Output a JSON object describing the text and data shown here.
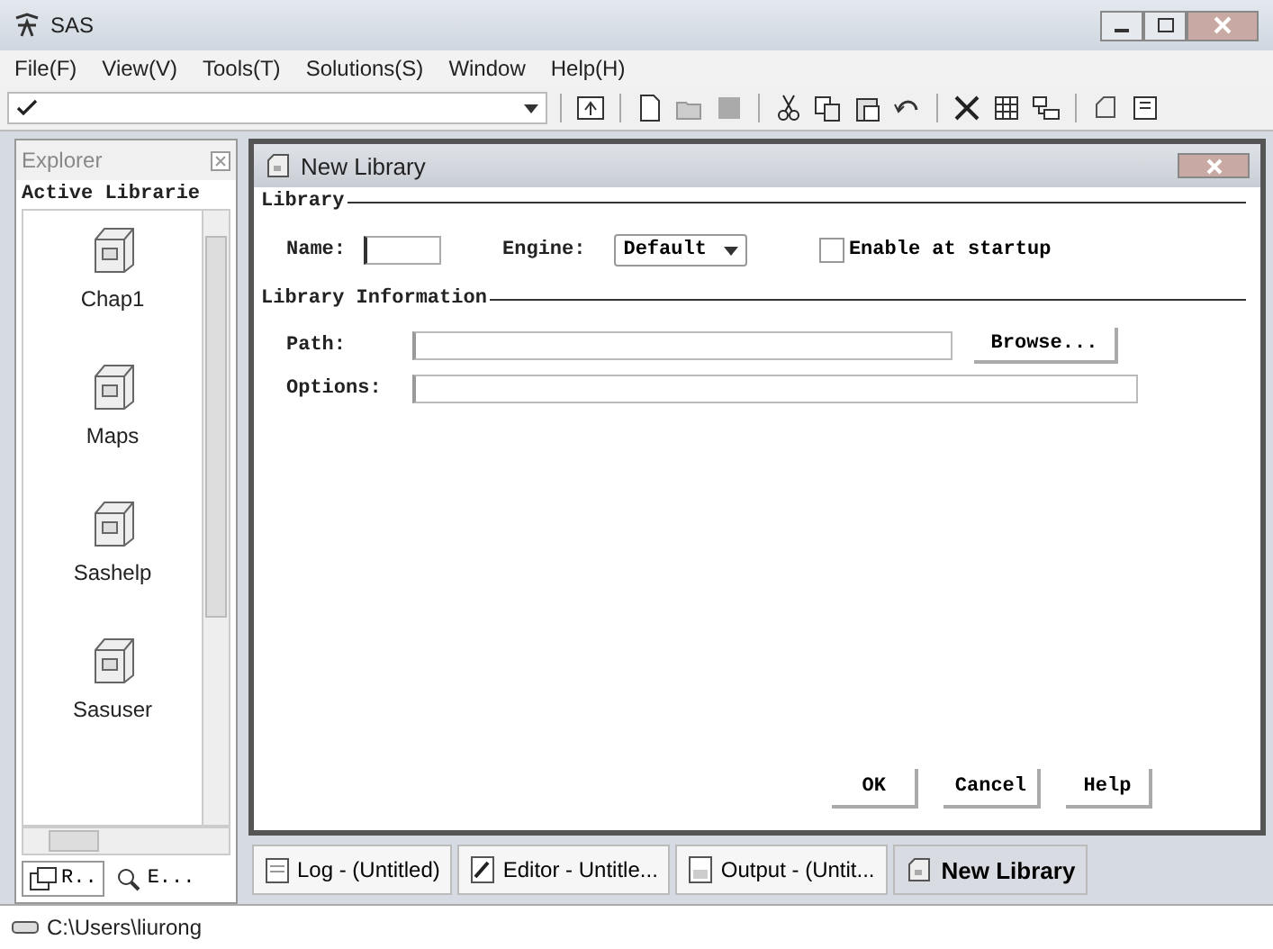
{
  "window": {
    "title": "SAS"
  },
  "menu": [
    "File(F)",
    "View(V)",
    "Tools(T)",
    "Solutions(S)",
    "Window",
    "Help(H)"
  ],
  "explorer": {
    "title": "Explorer",
    "header": "Active Librarie",
    "items": [
      {
        "label": "Chap1"
      },
      {
        "label": "Maps"
      },
      {
        "label": "Sashelp"
      },
      {
        "label": "Sasuser"
      }
    ],
    "tabs": [
      {
        "label": "R..",
        "selected": true
      },
      {
        "label": "E...",
        "selected": false
      }
    ]
  },
  "dialog": {
    "title": "New Library",
    "library_group": "Library",
    "name_label": "Name:",
    "engine_label": "Engine:",
    "engine_value": "Default",
    "startup": {
      "label": "Enable at startup",
      "checked": false
    },
    "info_group": "Library Information",
    "path_label": "Path:",
    "browse": "Browse...",
    "options_label": "Options:",
    "buttons": [
      "OK",
      "Cancel",
      "Help"
    ]
  },
  "taskbar": [
    {
      "label": "Log - (Untitled)",
      "kind": "log",
      "selected": false
    },
    {
      "label": "Editor - Untitle...",
      "kind": "editor",
      "selected": false
    },
    {
      "label": "Output - (Untit...",
      "kind": "output",
      "selected": false
    },
    {
      "label": "New Library",
      "kind": "library",
      "selected": true
    }
  ],
  "status_bar": "C:\\Users\\liurong"
}
